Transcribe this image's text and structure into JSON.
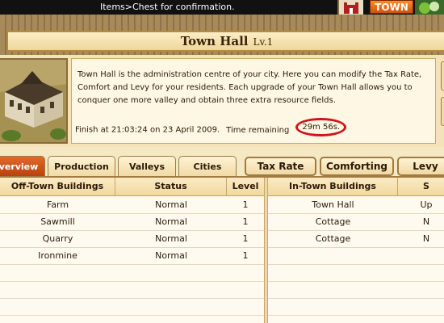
{
  "topbar": {
    "message": "Items>Chest for confirmation.",
    "town_button": "TOWN"
  },
  "header": {
    "title": "Town Hall",
    "level": "Lv.1"
  },
  "info": {
    "description": "Town Hall is the administration centre of your city. Here you can modify the Tax Rate, Comfort and Levy for your residents. Each upgrade of your Town Hall allows you to conquer one more valley and obtain three extra resource fields.",
    "finish": "Finish at 21:03:24 on 23 April 2009.",
    "remaining_label": "Time remaining",
    "remaining_value": "29m 56s.",
    "highlight_color": "#d0141b"
  },
  "tabs": [
    {
      "label": "verview",
      "active": true
    },
    {
      "label": "Production",
      "active": false
    },
    {
      "label": "Valleys",
      "active": false
    },
    {
      "label": "Cities",
      "active": false
    }
  ],
  "actions": [
    {
      "label": "Tax Rate"
    },
    {
      "label": "Comforting"
    },
    {
      "label": "Levy"
    }
  ],
  "off_town": {
    "headers": [
      "Off-Town Buildings",
      "Status",
      "Level"
    ],
    "rows": [
      [
        "Farm",
        "Normal",
        "1"
      ],
      [
        "Sawmill",
        "Normal",
        "1"
      ],
      [
        "Quarry",
        "Normal",
        "1"
      ],
      [
        "Ironmine",
        "Normal",
        "1"
      ]
    ]
  },
  "in_town": {
    "headers": [
      "In-Town Buildings",
      "S"
    ],
    "rows": [
      [
        "Town Hall",
        "Up"
      ],
      [
        "Cottage",
        "N"
      ],
      [
        "Cottage",
        "N"
      ]
    ]
  },
  "colors": {
    "accent": "#c8501a",
    "panel": "#fffaf0",
    "border": "#a07a40"
  }
}
